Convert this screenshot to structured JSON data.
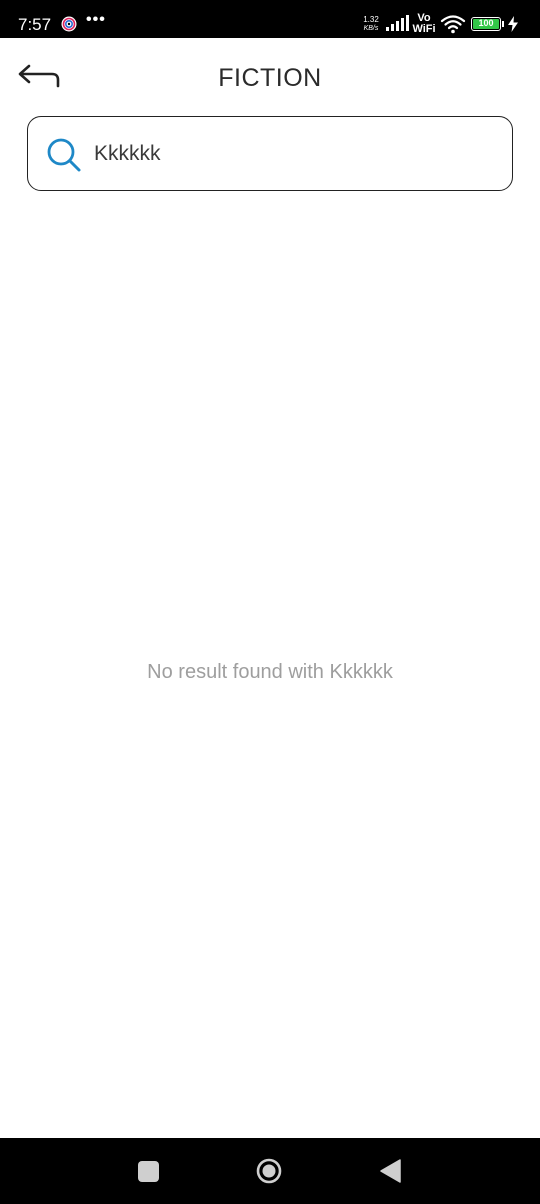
{
  "status_bar": {
    "time": "7:57",
    "dots": "•••",
    "net_speed_value": "1.32",
    "net_speed_unit": "KB/s",
    "vo_label": "Vo",
    "wifi_label": "WiFi",
    "battery_level": "100",
    "icons": [
      "app-notification-icon",
      "signal-icon",
      "wifi-icon",
      "battery-icon",
      "charging-icon"
    ]
  },
  "app_bar": {
    "title": "FICTION",
    "back_icon": "back-arrow-icon"
  },
  "search": {
    "icon": "search-icon",
    "value": "Kkkkkk",
    "accent_color": "#1e88c7"
  },
  "results": {
    "empty_message": "No result found with Kkkkkk"
  },
  "nav_bar": {
    "icons": [
      "recents-icon",
      "home-icon",
      "back-icon"
    ]
  },
  "colors": {
    "background": "#ffffff",
    "title_text": "#2b2b2b",
    "empty_text": "#9e9e9e",
    "battery": "#33c748"
  }
}
